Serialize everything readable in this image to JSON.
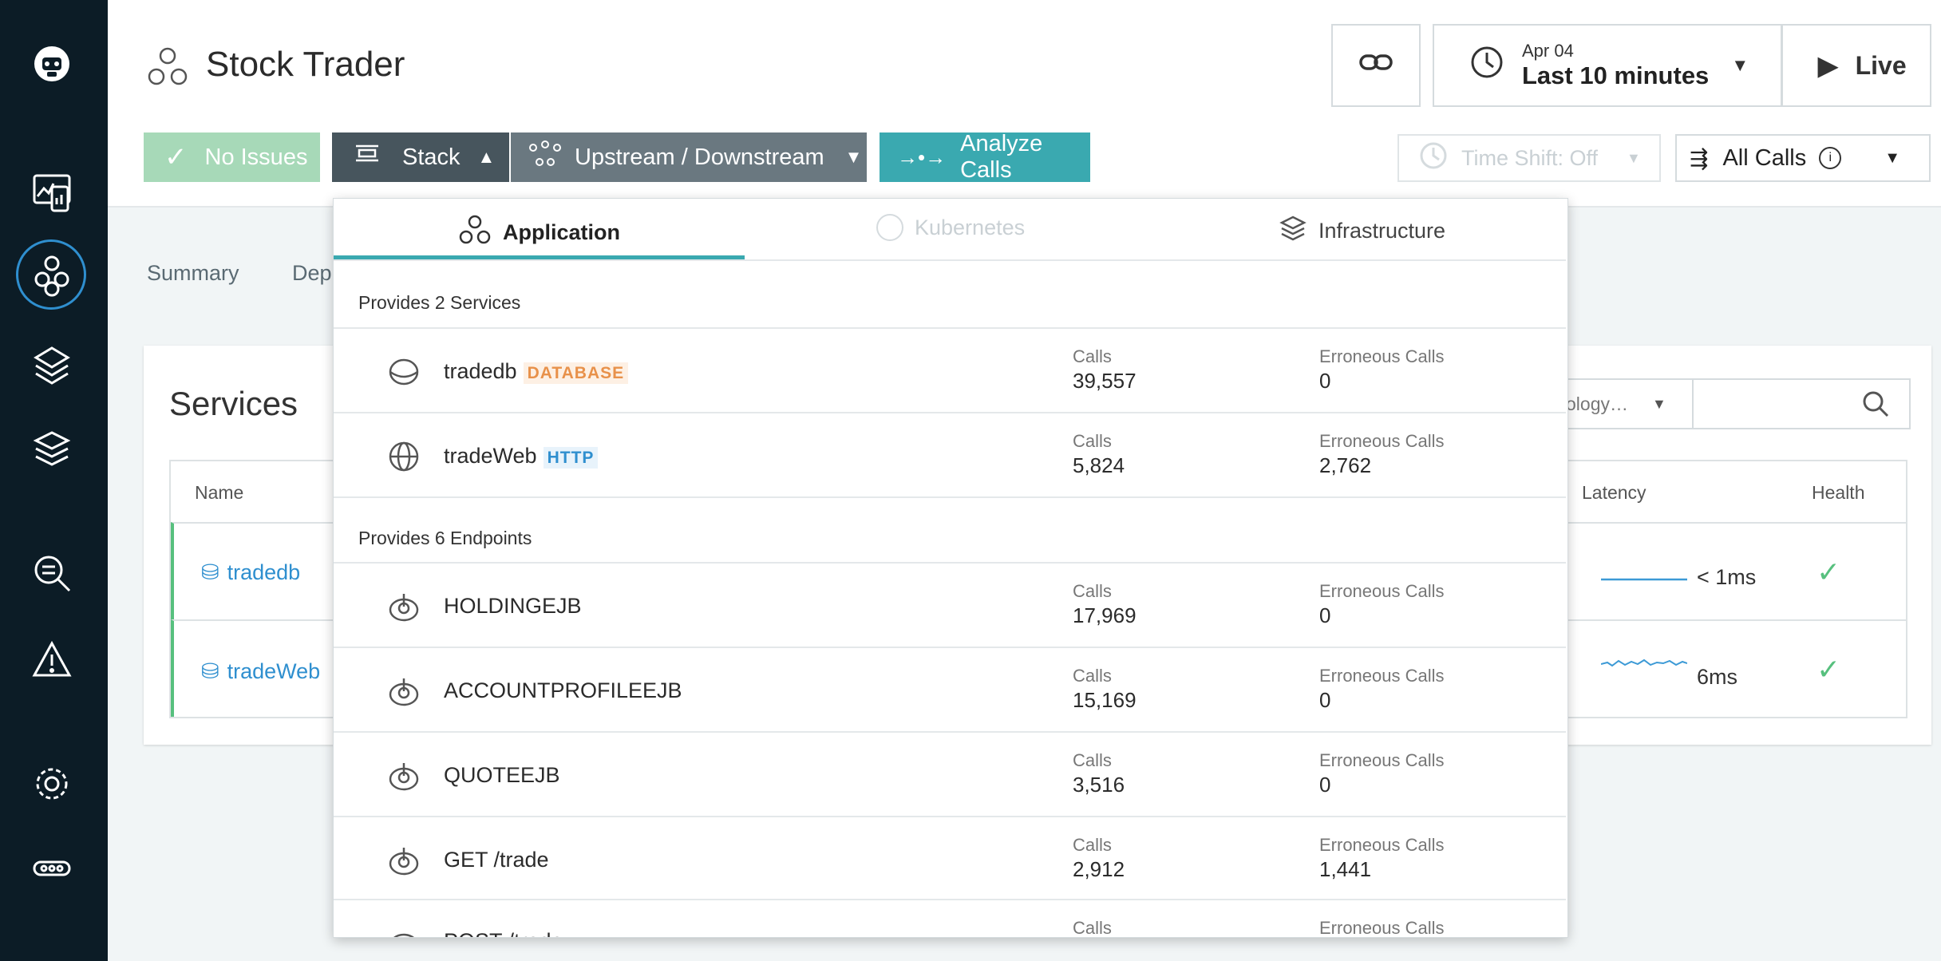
{
  "header": {
    "title": "Stock Trader",
    "status_button": "No Issues",
    "stack_button": "Stack",
    "upstream_button": "Upstream / Downstream",
    "analyze_button": "Analyze Calls",
    "date": "Apr 04",
    "time_range": "Last 10 minutes",
    "live_button": "Live",
    "timeshift": "Time Shift: Off",
    "calls_filter": "All Calls"
  },
  "tabs": [
    "Summary",
    "Dep"
  ],
  "services": {
    "title": "Services",
    "filter_placeholder": "ology…",
    "columns": {
      "name": "Name",
      "latency": "Latency",
      "health": "Health"
    },
    "rows": [
      {
        "name": "tradedb",
        "latency": "< 1ms"
      },
      {
        "name": "tradeWeb",
        "latency": "6ms"
      }
    ]
  },
  "dropdown": {
    "tabs": {
      "application": "Application",
      "kubernetes": "Kubernetes",
      "infrastructure": "Infrastructure"
    },
    "services_header": "Provides 2 Services",
    "endpoints_header": "Provides 6 Endpoints",
    "calls_label": "Calls",
    "errors_label": "Erroneous Calls",
    "services": [
      {
        "name": "tradedb",
        "tag": "DATABASE",
        "calls": "39,557",
        "errors": "0"
      },
      {
        "name": "tradeWeb",
        "tag": "HTTP",
        "calls": "5,824",
        "errors": "2,762"
      }
    ],
    "endpoints": [
      {
        "name": "HOLDINGEJB",
        "calls": "17,969",
        "errors": "0"
      },
      {
        "name": "ACCOUNTPROFILEEJB",
        "calls": "15,169",
        "errors": "0"
      },
      {
        "name": "QUOTEEJB",
        "calls": "3,516",
        "errors": "0"
      },
      {
        "name": "GET /trade",
        "calls": "2,912",
        "errors": "1,441"
      },
      {
        "name": "POST /trade",
        "calls": "",
        "errors": ""
      }
    ]
  },
  "colors": {
    "accent": "#3aa9b0",
    "nav": "#0c1c26",
    "ok": "#57c07e",
    "db_tag": "#e8914a",
    "http_tag": "#2f8fcf"
  }
}
